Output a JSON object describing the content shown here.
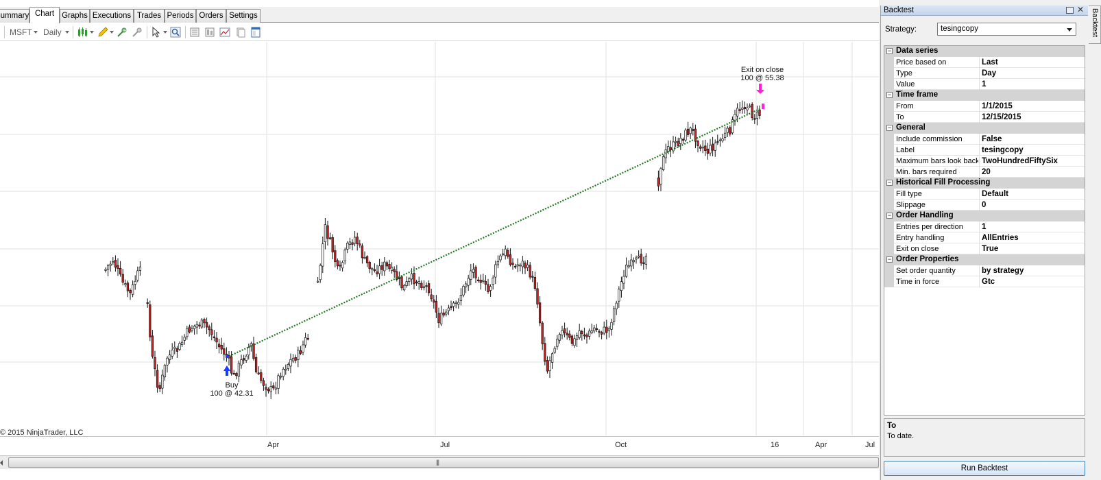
{
  "tabs": [
    "Summary",
    "Chart",
    "Graphs",
    "Executions",
    "Trades",
    "Periods",
    "Orders",
    "Settings"
  ],
  "active_tab": "Chart",
  "toolbar": {
    "instrument": "MSFT",
    "interval": "Daily"
  },
  "chart": {
    "instrument": "MSFT",
    "interval": "Daily",
    "copyright": "© 2015 NinjaTrader, LLC",
    "x_labels": [
      "Apr",
      "Jul",
      "Oct",
      "16",
      "Apr",
      "Jul"
    ],
    "entry": {
      "label": "Buy",
      "detail": "100 @ 42.31",
      "price": 42.31
    },
    "exit": {
      "label": "Exit on close",
      "detail": "100 @ 55.38",
      "price": 55.38
    }
  },
  "colors": {
    "up_fill": "#ffffff",
    "down_fill": "#cc2222",
    "trade_line": "#1f7a1f",
    "buy_arrow": "#1a3cff",
    "exit_arrow": "#ff22dd",
    "grid": "#e2e2e2"
  },
  "chart_data": {
    "type": "candlestick",
    "x_labels": [
      "Apr",
      "Jul",
      "Oct",
      "16",
      "Apr",
      "Jul"
    ],
    "trade": {
      "entry_price": 42.31,
      "exit_price": 55.38,
      "quantity": 100
    }
  },
  "panel": {
    "title": "Backtest",
    "side_tab": "Backtest",
    "strategy_label": "Strategy:",
    "strategy_value": "tesingcopy",
    "description_title": "To",
    "description_text": "To date.",
    "run_label": "Run Backtest",
    "sections": [
      {
        "name": "Data series",
        "rows": [
          {
            "name": "Price based on",
            "value": "Last"
          },
          {
            "name": "Type",
            "value": "Day"
          },
          {
            "name": "Value",
            "value": "1"
          }
        ]
      },
      {
        "name": "Time frame",
        "rows": [
          {
            "name": "From",
            "value": "1/1/2015"
          },
          {
            "name": "To",
            "value": "12/15/2015"
          }
        ]
      },
      {
        "name": "General",
        "rows": [
          {
            "name": "Include commission",
            "value": "False"
          },
          {
            "name": "Label",
            "value": "tesingcopy"
          },
          {
            "name": "Maximum bars look back",
            "value": "TwoHundredFiftySix"
          },
          {
            "name": "Min. bars required",
            "value": "20"
          }
        ]
      },
      {
        "name": "Historical Fill Processing",
        "rows": [
          {
            "name": "Fill type",
            "value": "Default"
          },
          {
            "name": "Slippage",
            "value": "0"
          }
        ]
      },
      {
        "name": "Order Handling",
        "rows": [
          {
            "name": "Entries per direction",
            "value": "1"
          },
          {
            "name": "Entry handling",
            "value": "AllEntries"
          },
          {
            "name": "Exit on close",
            "value": "True"
          }
        ]
      },
      {
        "name": "Order Properties",
        "rows": [
          {
            "name": "Set order quantity",
            "value": "by strategy"
          },
          {
            "name": "Time in force",
            "value": "Gtc"
          }
        ]
      }
    ]
  }
}
